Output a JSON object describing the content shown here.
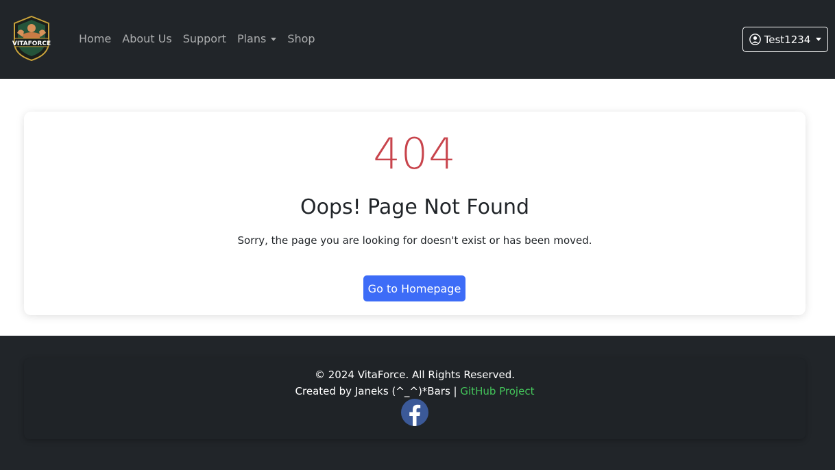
{
  "brand": {
    "name": "VITAFORCE",
    "icon": "vitaforce-logo"
  },
  "nav": {
    "items": [
      {
        "label": "Home"
      },
      {
        "label": "About Us"
      },
      {
        "label": "Support"
      },
      {
        "label": "Plans",
        "dropdown": true
      },
      {
        "label": "Shop"
      }
    ]
  },
  "user": {
    "name": "Test1234",
    "icon": "user-circle-icon"
  },
  "error": {
    "code": "404",
    "title": "Oops! Page Not Found",
    "message": "Sorry, the page you are looking for doesn't exist or has been moved.",
    "button_label": "Go to Homepage"
  },
  "footer": {
    "copyright": "© 2024 VitaForce. All Rights Reserved.",
    "credit": "Created by Janeks (^_^)*Bars",
    "separator": "|",
    "github_label": "GitHub Project",
    "social_icon": "facebook-icon"
  },
  "colors": {
    "navbar_bg": "#212529",
    "error_code": "#c8444c",
    "primary_button": "#3d6cf7",
    "github_link": "#43c35a",
    "facebook": "#3b5998"
  }
}
